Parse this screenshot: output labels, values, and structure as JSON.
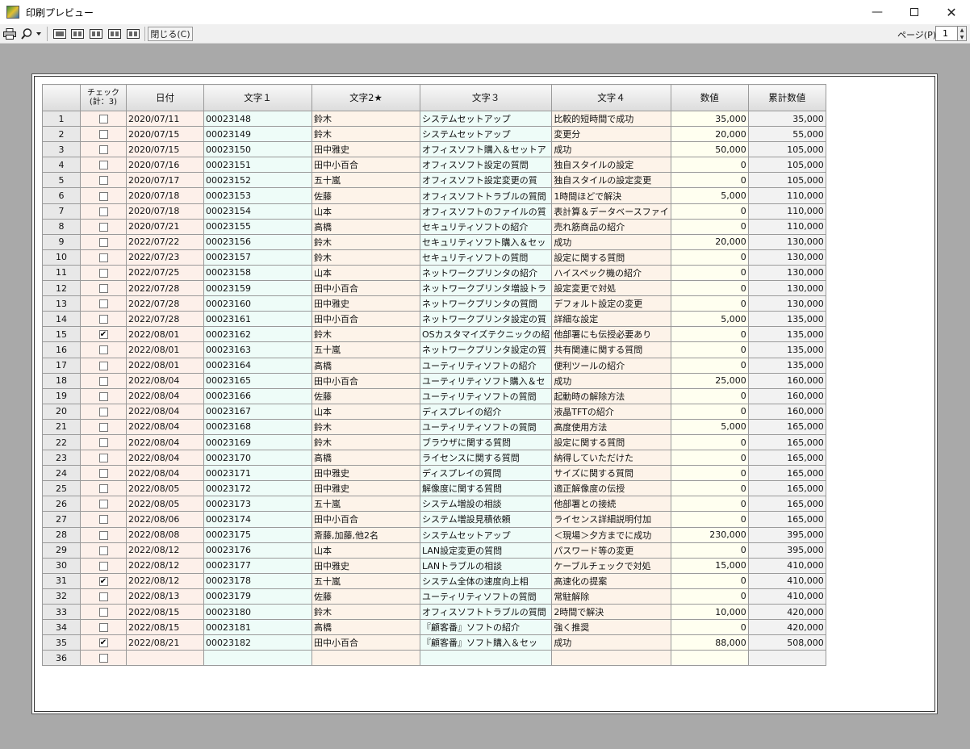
{
  "window": {
    "title": "印刷プレビュー",
    "minimize": "—",
    "close": "✕"
  },
  "toolbar": {
    "close_label": "閉じる(C)",
    "page_label": "ページ(P)",
    "page_value": "1"
  },
  "icons": {
    "print": "print-icon",
    "zoom": "zoom-icon"
  },
  "table": {
    "headers": {
      "rownum": "",
      "check_line1": "チェック",
      "check_line2": "(計：3)",
      "date": "日付",
      "text1": "文字１",
      "text2": "文字2★",
      "text3": "文字３",
      "text4": "文字４",
      "value": "数値",
      "cumulative": "累計数値"
    },
    "rows": [
      {
        "n": "1",
        "checked": false,
        "date": "2020/07/11",
        "t1": "00023148",
        "t2": "鈴木",
        "t3": "システムセットアップ",
        "t4": "比較的短時間で成功",
        "v": "35,000",
        "c": "35,000"
      },
      {
        "n": "2",
        "checked": false,
        "date": "2020/07/15",
        "t1": "00023149",
        "t2": "鈴木",
        "t3": "システムセットアップ",
        "t4": "変更分",
        "v": "20,000",
        "c": "55,000"
      },
      {
        "n": "3",
        "checked": false,
        "date": "2020/07/15",
        "t1": "00023150",
        "t2": "田中雅史",
        "t3": "オフィスソフト購入＆セットア",
        "t4": "成功",
        "v": "50,000",
        "c": "105,000"
      },
      {
        "n": "4",
        "checked": false,
        "date": "2020/07/16",
        "t1": "00023151",
        "t2": "田中小百合",
        "t3": "オフィスソフト設定の質問",
        "t4": "独自スタイルの設定",
        "v": "0",
        "c": "105,000"
      },
      {
        "n": "5",
        "checked": false,
        "date": "2020/07/17",
        "t1": "00023152",
        "t2": "五十嵐",
        "t3": "オフィスソフト設定変更の質",
        "t4": "独自スタイルの設定変更",
        "v": "0",
        "c": "105,000"
      },
      {
        "n": "6",
        "checked": false,
        "date": "2020/07/18",
        "t1": "00023153",
        "t2": "佐藤",
        "t3": "オフィスソフトトラブルの質問",
        "t4": "1時間ほどで解決",
        "v": "5,000",
        "c": "110,000"
      },
      {
        "n": "7",
        "checked": false,
        "date": "2020/07/18",
        "t1": "00023154",
        "t2": "山本",
        "t3": "オフィスソフトのファイルの質",
        "t4": "表計算＆データベースファイ",
        "v": "0",
        "c": "110,000"
      },
      {
        "n": "8",
        "checked": false,
        "date": "2020/07/21",
        "t1": "00023155",
        "t2": "高橋",
        "t3": "セキュリティソフトの紹介",
        "t4": "売れ筋商品の紹介",
        "v": "0",
        "c": "110,000"
      },
      {
        "n": "9",
        "checked": false,
        "date": "2022/07/22",
        "t1": "00023156",
        "t2": "鈴木",
        "t3": "セキュリティソフト購入＆セッ",
        "t4": "成功",
        "v": "20,000",
        "c": "130,000"
      },
      {
        "n": "10",
        "checked": false,
        "date": "2022/07/23",
        "t1": "00023157",
        "t2": "鈴木",
        "t3": "セキュリティソフトの質問",
        "t4": "設定に関する質問",
        "v": "0",
        "c": "130,000"
      },
      {
        "n": "11",
        "checked": false,
        "date": "2022/07/25",
        "t1": "00023158",
        "t2": "山本",
        "t3": "ネットワークプリンタの紹介",
        "t4": "ハイスペック機の紹介",
        "v": "0",
        "c": "130,000"
      },
      {
        "n": "12",
        "checked": false,
        "date": "2022/07/28",
        "t1": "00023159",
        "t2": "田中小百合",
        "t3": "ネットワークプリンタ増設トラ",
        "t4": "設定変更で対処",
        "v": "0",
        "c": "130,000"
      },
      {
        "n": "13",
        "checked": false,
        "date": "2022/07/28",
        "t1": "00023160",
        "t2": "田中雅史",
        "t3": "ネットワークプリンタの質問",
        "t4": "デフォルト設定の変更",
        "v": "0",
        "c": "130,000"
      },
      {
        "n": "14",
        "checked": false,
        "date": "2022/07/28",
        "t1": "00023161",
        "t2": "田中小百合",
        "t3": "ネットワークプリンタ設定の質",
        "t4": "詳細な設定",
        "v": "5,000",
        "c": "135,000"
      },
      {
        "n": "15",
        "checked": true,
        "date": "2022/08/01",
        "t1": "00023162",
        "t2": "鈴木",
        "t3": "OSカスタマイズテクニックの紹",
        "t4": "他部署にも伝授必要あり",
        "v": "0",
        "c": "135,000"
      },
      {
        "n": "16",
        "checked": false,
        "date": "2022/08/01",
        "t1": "00023163",
        "t2": "五十嵐",
        "t3": "ネットワークプリンタ設定の質",
        "t4": "共有関連に関する質問",
        "v": "0",
        "c": "135,000"
      },
      {
        "n": "17",
        "checked": false,
        "date": "2022/08/01",
        "t1": "00023164",
        "t2": "高橋",
        "t3": "ユーティリティソフトの紹介",
        "t4": "便利ツールの紹介",
        "v": "0",
        "c": "135,000"
      },
      {
        "n": "18",
        "checked": false,
        "date": "2022/08/04",
        "t1": "00023165",
        "t2": "田中小百合",
        "t3": "ユーティリティソフト購入＆セ",
        "t4": "成功",
        "v": "25,000",
        "c": "160,000"
      },
      {
        "n": "19",
        "checked": false,
        "date": "2022/08/04",
        "t1": "00023166",
        "t2": "佐藤",
        "t3": "ユーティリティソフトの質問",
        "t4": "起動時の解除方法",
        "v": "0",
        "c": "160,000"
      },
      {
        "n": "20",
        "checked": false,
        "date": "2022/08/04",
        "t1": "00023167",
        "t2": "山本",
        "t3": "ディスプレイの紹介",
        "t4": "液晶TFTの紹介",
        "v": "0",
        "c": "160,000"
      },
      {
        "n": "21",
        "checked": false,
        "date": "2022/08/04",
        "t1": "00023168",
        "t2": "鈴木",
        "t3": "ユーティリティソフトの質問",
        "t4": "高度使用方法",
        "v": "5,000",
        "c": "165,000"
      },
      {
        "n": "22",
        "checked": false,
        "date": "2022/08/04",
        "t1": "00023169",
        "t2": "鈴木",
        "t3": "ブラウザに関する質問",
        "t4": "設定に関する質問",
        "v": "0",
        "c": "165,000"
      },
      {
        "n": "23",
        "checked": false,
        "date": "2022/08/04",
        "t1": "00023170",
        "t2": "高橋",
        "t3": "ライセンスに関する質問",
        "t4": "納得していただけた",
        "v": "0",
        "c": "165,000"
      },
      {
        "n": "24",
        "checked": false,
        "date": "2022/08/04",
        "t1": "00023171",
        "t2": "田中雅史",
        "t3": "ディスプレイの質問",
        "t4": "サイズに関する質問",
        "v": "0",
        "c": "165,000"
      },
      {
        "n": "25",
        "checked": false,
        "date": "2022/08/05",
        "t1": "00023172",
        "t2": "田中雅史",
        "t3": "解像度に関する質問",
        "t4": "適正解像度の伝授",
        "v": "0",
        "c": "165,000"
      },
      {
        "n": "26",
        "checked": false,
        "date": "2022/08/05",
        "t1": "00023173",
        "t2": "五十嵐",
        "t3": "システム増設の相談",
        "t4": "他部署との接続",
        "v": "0",
        "c": "165,000"
      },
      {
        "n": "27",
        "checked": false,
        "date": "2022/08/06",
        "t1": "00023174",
        "t2": "田中小百合",
        "t3": "システム増設見積依頼",
        "t4": "ライセンス詳細説明付加",
        "v": "0",
        "c": "165,000"
      },
      {
        "n": "28",
        "checked": false,
        "date": "2022/08/08",
        "t1": "00023175",
        "t2": "斎藤,加藤,他2名",
        "t3": "システムセットアップ",
        "t4": "＜現場＞夕方までに成功",
        "v": "230,000",
        "c": "395,000"
      },
      {
        "n": "29",
        "checked": false,
        "date": "2022/08/12",
        "t1": "00023176",
        "t2": "山本",
        "t3": "LAN設定変更の質問",
        "t4": "パスワード等の変更",
        "v": "0",
        "c": "395,000"
      },
      {
        "n": "30",
        "checked": false,
        "date": "2022/08/12",
        "t1": "00023177",
        "t2": "田中雅史",
        "t3": "LANトラブルの相談",
        "t4": "ケーブルチェックで対処",
        "v": "15,000",
        "c": "410,000"
      },
      {
        "n": "31",
        "checked": true,
        "date": "2022/08/12",
        "t1": "00023178",
        "t2": "五十嵐",
        "t3": "システム全体の速度向上相",
        "t4": "高速化の提案",
        "v": "0",
        "c": "410,000"
      },
      {
        "n": "32",
        "checked": false,
        "date": "2022/08/13",
        "t1": "00023179",
        "t2": "佐藤",
        "t3": "ユーティリティソフトの質問",
        "t4": "常駐解除",
        "v": "0",
        "c": "410,000"
      },
      {
        "n": "33",
        "checked": false,
        "date": "2022/08/15",
        "t1": "00023180",
        "t2": "鈴木",
        "t3": "オフィスソフトトラブルの質問",
        "t4": "2時間で解決",
        "v": "10,000",
        "c": "420,000"
      },
      {
        "n": "34",
        "checked": false,
        "date": "2022/08/15",
        "t1": "00023181",
        "t2": "高橋",
        "t3": "『顧客番』ソフトの紹介",
        "t4": "強く推奨",
        "v": "0",
        "c": "420,000"
      },
      {
        "n": "35",
        "checked": true,
        "date": "2022/08/21",
        "t1": "00023182",
        "t2": "田中小百合",
        "t3": "『顧客番』ソフト購入＆セッ",
        "t4": "成功",
        "v": "88,000",
        "c": "508,000"
      },
      {
        "n": "36",
        "checked": false,
        "date": "",
        "t1": "",
        "t2": "",
        "t3": "",
        "t4": "",
        "v": "",
        "c": ""
      }
    ]
  }
}
